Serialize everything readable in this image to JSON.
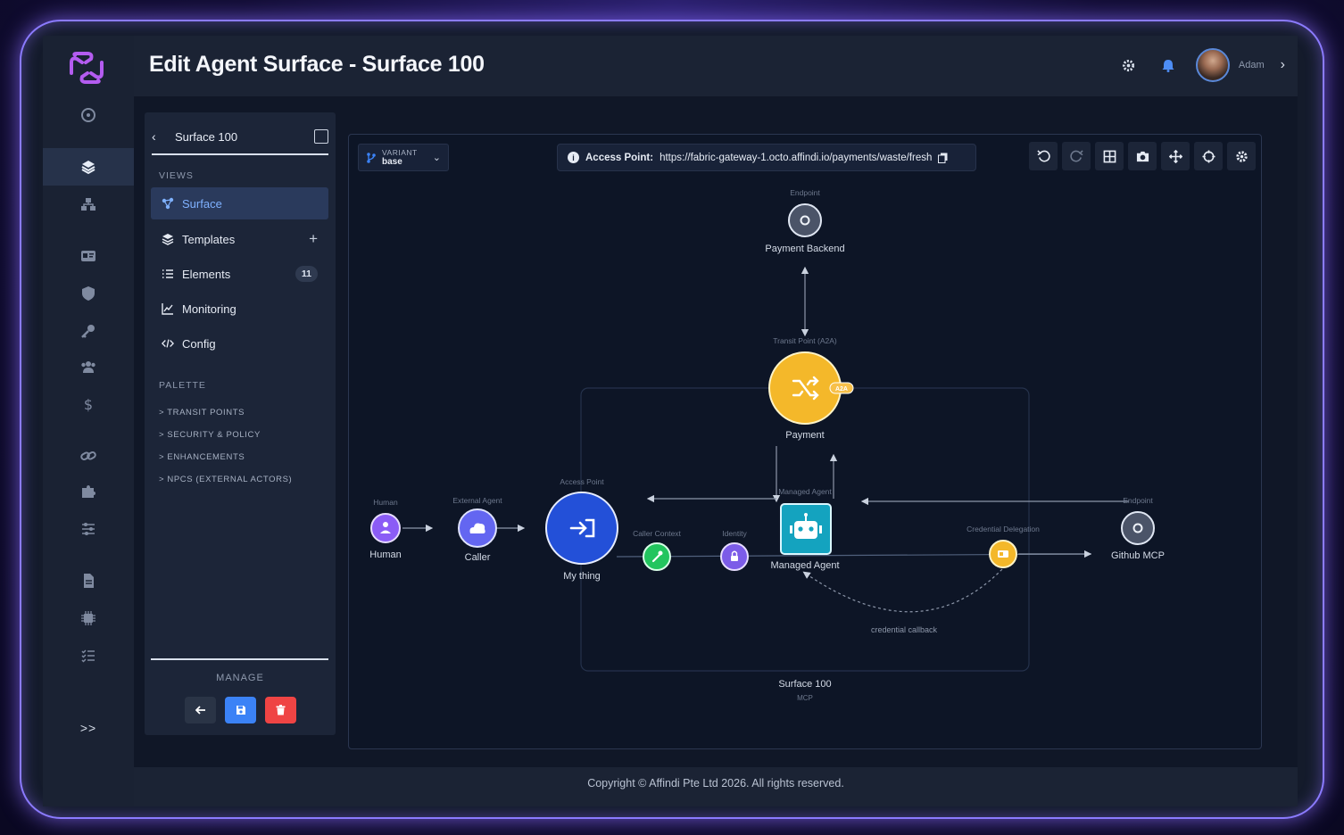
{
  "page": {
    "title": "Edit Agent Surface - Surface 100"
  },
  "header": {
    "user_name": "Adam"
  },
  "rail": {
    "expand_label": ">>"
  },
  "panel": {
    "title": "Surface 100",
    "views_label": "VIEWS",
    "views": [
      {
        "label": "Surface"
      },
      {
        "label": "Templates"
      },
      {
        "label": "Elements",
        "count": "11"
      },
      {
        "label": "Monitoring"
      },
      {
        "label": "Config"
      }
    ],
    "palette_label": "PALETTE",
    "palette": [
      "> TRANSIT POINTS",
      "> SECURITY & POLICY",
      "> ENHANCEMENTS",
      "> NPCS (EXTERNAL ACTORS)"
    ],
    "manage_label": "MANAGE"
  },
  "canvas": {
    "variant_label": "VARIANT",
    "variant_value": "base",
    "access_prefix": "Access Point:",
    "access_url": "https://fabric-gateway-1.octo.affindi.io/payments/waste/fresh"
  },
  "graph": {
    "nodes": {
      "payment_backend": {
        "type": "Endpoint",
        "label": "Payment Backend"
      },
      "payment": {
        "type": "Transit Point (A2A)",
        "label": "Payment",
        "badge": "A2A"
      },
      "human": {
        "type": "Human",
        "label": "Human"
      },
      "caller": {
        "type": "External Agent",
        "label": "Caller"
      },
      "my_thing": {
        "type": "Access Point",
        "label": "My thing"
      },
      "caller_context": {
        "type": "Caller Context"
      },
      "identity": {
        "type": "Identity"
      },
      "managed_agent": {
        "type": "Managed Agent",
        "label": "Managed Agent"
      },
      "credential_delegation": {
        "type": "Credential Delegation"
      },
      "github_mcp": {
        "type": "Endpoint",
        "label": "Github MCP"
      }
    },
    "edge_label_callback": "credential callback",
    "group_label": "Surface 100",
    "group_sublabel": "MCP"
  },
  "colors": {
    "accent": "#3b82f6",
    "payment": "#f4b82a",
    "managed_agent": "#14a3bf",
    "human": "#8b5cf6",
    "caller_context": "#22c55e",
    "delete": "#ef4444",
    "frame_glow": "#8b7bff"
  },
  "footer": {
    "copyright": "Copyright © Affindi Pte Ltd 2026. All rights reserved."
  }
}
